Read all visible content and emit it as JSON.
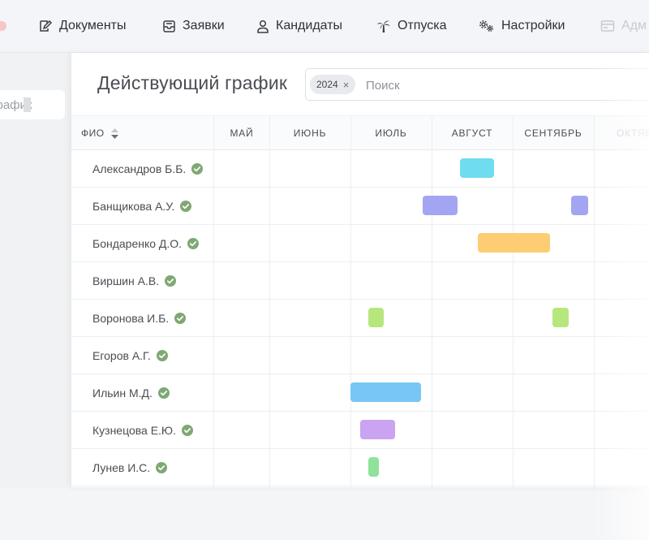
{
  "nav": {
    "items": [
      {
        "label": "Документы",
        "icon": "edit-document-icon"
      },
      {
        "label": "Заявки",
        "icon": "inbox-icon"
      },
      {
        "label": "Кандидаты",
        "icon": "user-icon"
      },
      {
        "label": "Отпуска",
        "icon": "palm-tree-icon"
      },
      {
        "label": "Настройки",
        "icon": "gears-icon"
      },
      {
        "label": "Адм",
        "icon": "id-card-icon"
      }
    ]
  },
  "sidebar": {
    "active_item": "график"
  },
  "page": {
    "title": "Действующий график"
  },
  "search": {
    "chip": "2024",
    "chip_close": "×",
    "placeholder": "Поиск",
    "value": ""
  },
  "table": {
    "name_header": "ФИО",
    "months": [
      "МАЙ",
      "ИЮНЬ",
      "ИЮЛЬ",
      "АВГУСТ",
      "СЕНТЯБРЬ",
      "ОКТЯБ"
    ],
    "status_color": "#7fa874",
    "rows": [
      {
        "name": "Александров Б.Б.",
        "bars": [
          {
            "color": "#6fdcef",
            "start": 3.35,
            "end": 3.77
          }
        ]
      },
      {
        "name": "Банщикова А.У.",
        "bars": [
          {
            "color": "#a3a5f2",
            "start": 2.89,
            "end": 3.32
          },
          {
            "color": "#a3a5f2",
            "start": 4.72,
            "end": 4.93
          }
        ]
      },
      {
        "name": "Бондаренко Д.О.",
        "bars": [
          {
            "color": "#fccd73",
            "start": 3.57,
            "end": 4.46
          }
        ]
      },
      {
        "name": "Виршин А.В.",
        "bars": []
      },
      {
        "name": "Воронова И.Б.",
        "bars": [
          {
            "color": "#b5e77c",
            "start": 2.22,
            "end": 2.41
          },
          {
            "color": "#b5e77c",
            "start": 4.49,
            "end": 4.69
          }
        ]
      },
      {
        "name": "Егоров А.Г.",
        "bars": []
      },
      {
        "name": "Ильин М.Д.",
        "bars": [
          {
            "color": "#78c6f5",
            "start": 2.0,
            "end": 2.87
          }
        ]
      },
      {
        "name": "Кузнецова Е.Ю.",
        "bars": [
          {
            "color": "#caa3f2",
            "start": 2.12,
            "end": 2.55
          }
        ]
      },
      {
        "name": "Лунев И.С.",
        "bars": [
          {
            "color": "#8ee29a",
            "start": 2.22,
            "end": 2.35
          }
        ]
      }
    ]
  }
}
